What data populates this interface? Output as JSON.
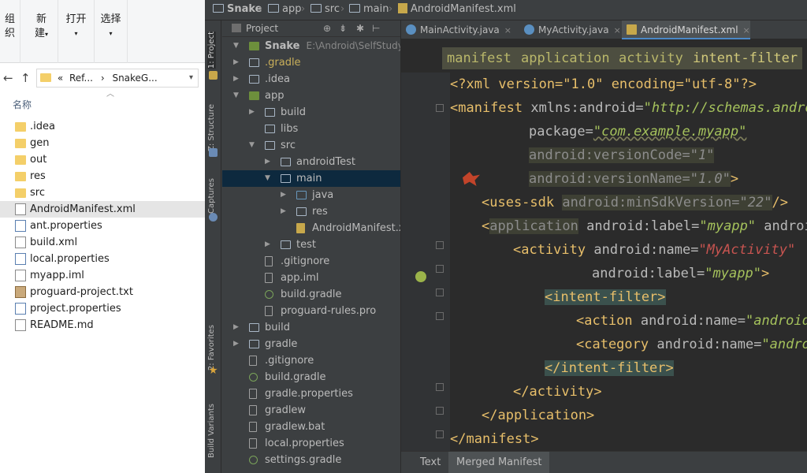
{
  "explorer": {
    "ribbon": {
      "organize": "组织",
      "new_top": "新",
      "new_bottom": "建",
      "open": "打开",
      "select": "选择"
    },
    "nav": {
      "back": "←",
      "up": "↑"
    },
    "address": {
      "prefix": "«",
      "part1": "Ref...",
      "sep": "›",
      "part2": "SnakeG...",
      "dropdown": "▾"
    },
    "column_header": "名称",
    "files": [
      {
        "name": ".idea",
        "type": "folder"
      },
      {
        "name": "gen",
        "type": "folder"
      },
      {
        "name": "out",
        "type": "folder"
      },
      {
        "name": "res",
        "type": "folder"
      },
      {
        "name": "src",
        "type": "folder"
      },
      {
        "name": "AndroidManifest.xml",
        "type": "file",
        "selected": true
      },
      {
        "name": "ant.properties",
        "type": "prop"
      },
      {
        "name": "build.xml",
        "type": "file"
      },
      {
        "name": "local.properties",
        "type": "prop"
      },
      {
        "name": "myapp.iml",
        "type": "file"
      },
      {
        "name": "proguard-project.txt",
        "type": "proguard"
      },
      {
        "name": "project.properties",
        "type": "prop"
      },
      {
        "name": "README.md",
        "type": "file"
      }
    ]
  },
  "ide": {
    "navbar": {
      "snake": "Snake",
      "app": "app",
      "src": "src",
      "main": "main",
      "file": "AndroidManifest.xml"
    },
    "tool_windows": {
      "project": "1: Project",
      "structure": "Z: Structure",
      "captures": "Captures",
      "favorites": "2: Favorites",
      "build_variants": "Build Variants"
    },
    "project_panel": {
      "view_label": "Project",
      "tree": [
        {
          "label": "Snake",
          "path": "E:\\Android\\SelfStudy\\Snake",
          "depth": 0,
          "arrow": "▼",
          "icon": "mod",
          "head": true
        },
        {
          "label": ".gradle",
          "depth": 0,
          "arrow": "▶",
          "icon": "fold",
          "dim": true
        },
        {
          "label": ".idea",
          "depth": 0,
          "arrow": "▶",
          "icon": "fold"
        },
        {
          "label": "app",
          "depth": 0,
          "arrow": "▼",
          "icon": "mod"
        },
        {
          "label": "build",
          "depth": 1,
          "arrow": "▶",
          "icon": "fold"
        },
        {
          "label": "libs",
          "depth": 1,
          "arrow": "",
          "icon": "fold"
        },
        {
          "label": "src",
          "depth": 1,
          "arrow": "▼",
          "icon": "fold"
        },
        {
          "label": "androidTest",
          "depth": 2,
          "arrow": "▶",
          "icon": "fold"
        },
        {
          "label": "main",
          "depth": 2,
          "arrow": "▼",
          "icon": "fold",
          "selected": true
        },
        {
          "label": "java",
          "depth": 3,
          "arrow": "▶",
          "icon": "src"
        },
        {
          "label": "res",
          "depth": 3,
          "arrow": "▶",
          "icon": "fold"
        },
        {
          "label": "AndroidManifest.xml",
          "depth": 3,
          "arrow": "",
          "icon": "xml"
        },
        {
          "label": "test",
          "depth": 2,
          "arrow": "▶",
          "icon": "fold"
        },
        {
          "label": ".gitignore",
          "depth": 1,
          "arrow": "",
          "icon": "fl"
        },
        {
          "label": "app.iml",
          "depth": 1,
          "arrow": "",
          "icon": "fl"
        },
        {
          "label": "build.gradle",
          "depth": 1,
          "arrow": "",
          "icon": "gr"
        },
        {
          "label": "proguard-rules.pro",
          "depth": 1,
          "arrow": "",
          "icon": "fl"
        },
        {
          "label": "build",
          "depth": 0,
          "arrow": "▶",
          "icon": "fold"
        },
        {
          "label": "gradle",
          "depth": 0,
          "arrow": "▶",
          "icon": "fold"
        },
        {
          "label": ".gitignore",
          "depth": 0,
          "arrow": "",
          "icon": "fl"
        },
        {
          "label": "build.gradle",
          "depth": 0,
          "arrow": "",
          "icon": "gr"
        },
        {
          "label": "gradle.properties",
          "depth": 0,
          "arrow": "",
          "icon": "fl"
        },
        {
          "label": "gradlew",
          "depth": 0,
          "arrow": "",
          "icon": "fl"
        },
        {
          "label": "gradlew.bat",
          "depth": 0,
          "arrow": "",
          "icon": "fl"
        },
        {
          "label": "local.properties",
          "depth": 0,
          "arrow": "",
          "icon": "fl"
        },
        {
          "label": "settings.gradle",
          "depth": 0,
          "arrow": "",
          "icon": "gr"
        }
      ]
    },
    "editor": {
      "tabs": [
        {
          "label": "MainActivity.java",
          "icon": "class"
        },
        {
          "label": "MyActivity.java",
          "icon": "class"
        },
        {
          "label": "AndroidManifest.xml",
          "icon": "xml",
          "active": true
        }
      ],
      "close_glyph": "×",
      "breadcrumbs": [
        "manifest",
        "application",
        "activity",
        "intent-filter"
      ],
      "code": {
        "l1": "<?xml version=\"1.0\" encoding=\"utf-8\"?>",
        "manifest_open": "<manifest",
        "xmlns": "xmlns:android=",
        "xmlns_val": "\"http://schemas.android",
        "package_attr": "package=",
        "package_val": "\"com.example.myapp\"",
        "vcode_attr": "android:versionCode=",
        "vcode_val": "\"1\"",
        "vname_attr": "android:versionName=",
        "vname_val": "\"1.0\"",
        "close_bracket": ">",
        "uses_sdk": "<uses-sdk",
        "minsdk_attr": "android:minSdkVersion=",
        "minsdk_val": "\"22\"",
        "self_close": "/>",
        "app_open_lt": "<",
        "app_open_name": "application",
        "app_label_attr": "android:label=",
        "app_label_val": "\"myapp\"",
        "app_more": "android",
        "act_open": "<activity",
        "act_name_attr": "android:name=",
        "act_name_val": "\"MyActivity\"",
        "act_label_attr": "android:label=",
        "act_label_val": "\"myapp\"",
        "if_open": "<intent-filter>",
        "action_open": "<action",
        "action_attr": "android:name=",
        "action_val": "\"android.",
        "category_open": "<category",
        "category_attr": "android:name=",
        "category_val": "\"androi",
        "if_close": "</intent-filter>",
        "act_close": "</activity>",
        "app_close": "</application>",
        "manifest_close": "</manifest>"
      }
    },
    "bottom_tabs": {
      "text": "Text",
      "merged": "Merged Manifest"
    }
  }
}
